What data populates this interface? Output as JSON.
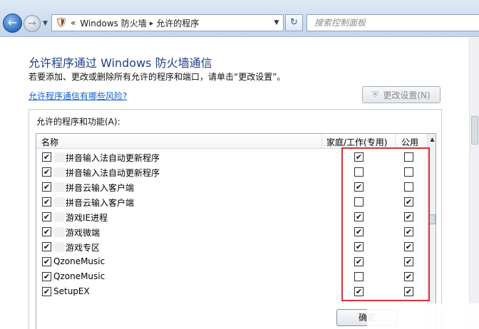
{
  "nav": {
    "back_glyph": "←",
    "forward_glyph": "→",
    "breadcrumb_prefix": "«",
    "breadcrumb": [
      "Windows 防火墙",
      "允许的程序"
    ],
    "breadcrumb_sep": "▸",
    "search_placeholder": "搜索控制面板"
  },
  "main": {
    "title": "允许程序通过 Windows 防火墙通信",
    "description": "若要添加、更改或删除所有允许的程序和端口，请单击“更改设置”。",
    "risk_link": "允许程序通信有哪些风险?",
    "change_settings_button": "更改设置(N)",
    "group_label": "允许的程序和功能(A):",
    "columns": {
      "name": "名称",
      "home_work": "家庭/工作(专用)",
      "public": "公用"
    },
    "programs": [
      {
        "name": "拼音输入法自动更新程序",
        "enabled": true,
        "home": true,
        "public": false,
        "masked": true
      },
      {
        "name": "拼音输入法自动更新程序",
        "enabled": true,
        "home": false,
        "public": false,
        "masked": true
      },
      {
        "name": "拼音云输入客户端",
        "enabled": true,
        "home": true,
        "public": false,
        "masked": true
      },
      {
        "name": "拼音云输入客户端",
        "enabled": true,
        "home": false,
        "public": true,
        "masked": true
      },
      {
        "name": "游戏IE进程",
        "enabled": true,
        "home": true,
        "public": true,
        "masked": true
      },
      {
        "name": "游戏微端",
        "enabled": true,
        "home": true,
        "public": true,
        "masked": true
      },
      {
        "name": "游戏专区",
        "enabled": true,
        "home": true,
        "public": true,
        "masked": true
      },
      {
        "name": "QzoneMusic",
        "enabled": true,
        "home": true,
        "public": true,
        "masked": false
      },
      {
        "name": "QzoneMusic",
        "enabled": true,
        "home": false,
        "public": true,
        "masked": false
      },
      {
        "name": "SetupEX",
        "enabled": true,
        "home": true,
        "public": true,
        "masked": false
      }
    ],
    "ok_button": "确定"
  },
  "colors": {
    "highlight_box": "#d63434",
    "title": "#1e3f8b",
    "link": "#0f5fc9"
  },
  "icons": [
    "back-arrow-icon",
    "forward-arrow-icon",
    "control-panel-icon",
    "refresh-icon",
    "shield-icon",
    "checkbox-icon"
  ]
}
